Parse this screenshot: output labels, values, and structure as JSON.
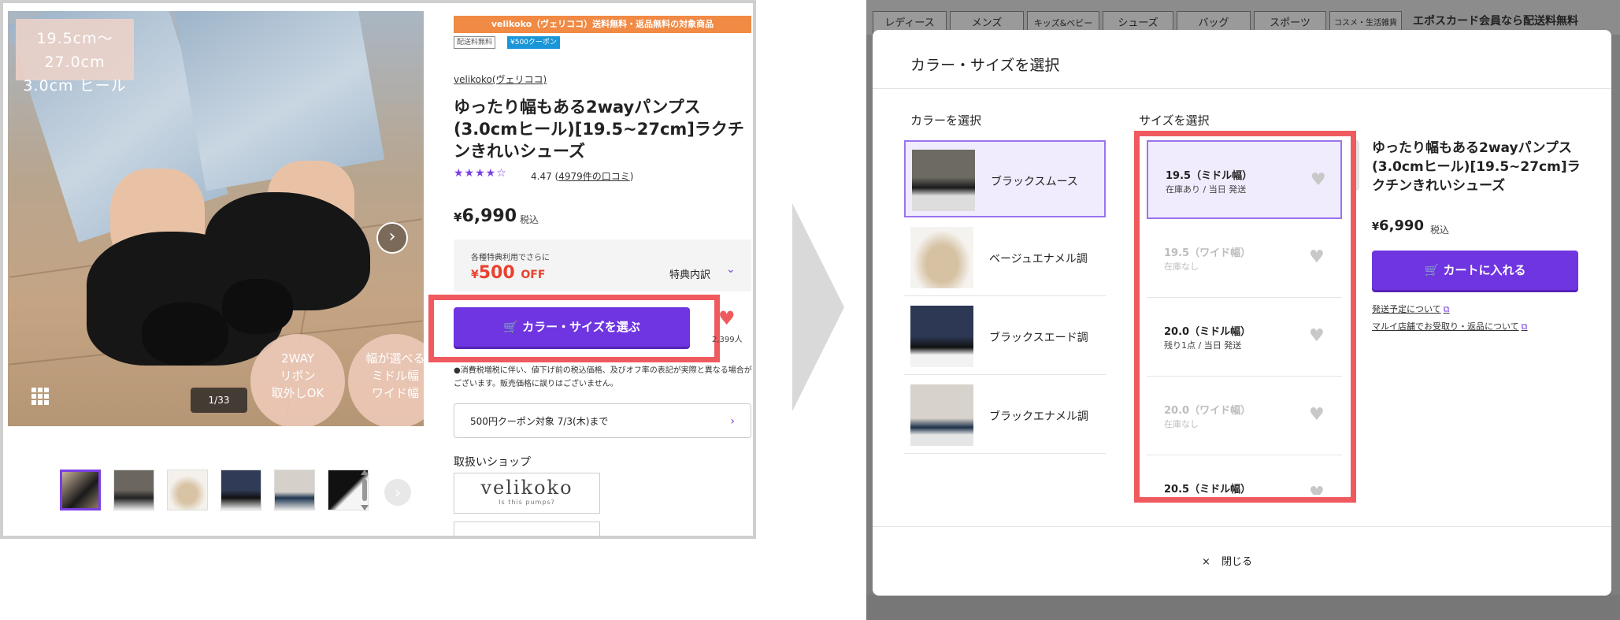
{
  "left": {
    "photo": {
      "heel_badge": [
        "19.5cm〜27.0cm",
        "3.0cm ヒール"
      ],
      "badge_2way": [
        "2WAY",
        "リボン",
        "取外しOK"
      ],
      "badge_width": [
        "幅が選べる",
        "ミドル幅",
        "ワイド幅"
      ],
      "counter": "1/33",
      "next_icon": "chevron-right-icon",
      "grid_icon": "grid-icon"
    },
    "thumbnails_count": 6,
    "product": {
      "banner": "velikoko（ヴェリココ）送料無料・返品無料の対象商品",
      "tag_shipping": "配送料無料",
      "tag_coupon": "¥500クーポン",
      "brand": "velikoko(ヴェリココ)",
      "title": "ゆったり幅もある2wayパンプス(3.0cmヒール)[19.5~27cm]ラクチンきれいシューズ",
      "stars": "★★★★☆",
      "rating_value": "4.47",
      "rating_open": " (",
      "rating_link": "4979件の口コミ",
      "rating_close": ")",
      "price_yen": "¥",
      "price": "6,990",
      "tax": "税込",
      "discount_small": "各種特典利用でさらに",
      "discount_yen": "¥",
      "discount_amount": "500",
      "discount_off": "OFF",
      "discount_detail": "特典内訳",
      "select_button": "カラー・サイズを選ぶ",
      "fav_count": "2,399人",
      "notice": "●消費税増税に伴い、値下げ前の税込価格、及びオフ率の表記が実際と異なる場合がございます。販売価格に誤りはございません。",
      "coupon_row": "500円クーポン対象 7/3(木)まで",
      "shop_heading": "取扱いショップ",
      "shop_logo_main": "velikoko",
      "shop_logo_sub": "Is this pumps?"
    }
  },
  "right": {
    "categories": [
      "レディース",
      "メンズ",
      "キッズ&ベビー",
      "シューズ",
      "バッグ",
      "スポーツ",
      "コスメ・生活雑貨"
    ],
    "promo_text": "エポスカード会員なら配送料無料",
    "modal": {
      "title": "カラー・サイズを選択",
      "color_heading": "カラーを選択",
      "size_heading": "サイズを選択",
      "colors": [
        {
          "label": "ブラックスムース",
          "selected": true
        },
        {
          "label": "ベージュエナメル調",
          "selected": false
        },
        {
          "label": "ブラックスエード調",
          "selected": false
        },
        {
          "label": "ブラックエナメル調",
          "selected": false
        }
      ],
      "sizes": [
        {
          "name": "19.5（ミドル幅）",
          "stock": "在庫あり / 当日 発送",
          "state": "selected"
        },
        {
          "name": "19.5（ワイド幅）",
          "stock": "在庫なし",
          "state": "disabled"
        },
        {
          "name": "20.0（ミドル幅）",
          "stock": "残り1点 / 当日 発送",
          "state": "available"
        },
        {
          "name": "20.0（ワイド幅）",
          "stock": "在庫なし",
          "state": "disabled"
        },
        {
          "name": "20.5（ミドル幅）",
          "stock": "",
          "state": "available"
        }
      ],
      "product_title": "ゆったり幅もある2wayパンプス(3.0cmヒール)[19.5~27cm]ラクチンきれいシューズ",
      "price_yen": "¥",
      "price": "6,990",
      "tax": "税込",
      "cart_button": "カートに入れる",
      "link_shipping": "発送予定について",
      "link_store": "マルイ店舗でお受取り・返品について",
      "close_label": "閉じる",
      "close_icon": "×"
    }
  },
  "colors": {
    "accent": "#6f35e0",
    "highlight_frame": "#ef5a5f",
    "discount_red": "#e8412f",
    "banner_orange": "#f08a44"
  }
}
